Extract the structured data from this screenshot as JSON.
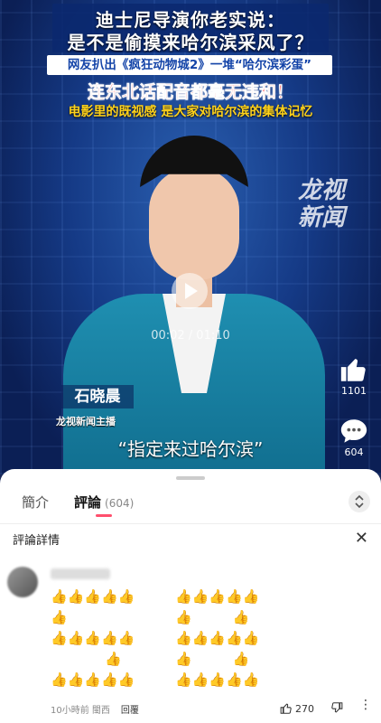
{
  "video": {
    "headline_line1": "迪士尼导演你老实说：",
    "headline_line2": "是不是偷摸来哈尔滨采风了？",
    "sub_banner": "网友扒出《疯狂动物城2》一堆“哈尔滨彩蛋”",
    "red_line": "连东北话配音都毫无违和！",
    "yellow_line": "电影里的既视感 是大家对哈尔滨的集体记忆",
    "watermark_line1": "龙视",
    "watermark_line2": "新闻",
    "time_display": "00:02 / 01:10",
    "anchor_name": "石晓晨",
    "anchor_title": "龙视新闻主播",
    "caption": "“指定来过哈尔滨”"
  },
  "side_actions": {
    "like_count": "1101",
    "comment_count": "604"
  },
  "sheet": {
    "tab_intro": "簡介",
    "tab_comments": "評論",
    "tab_comments_count": "(604)",
    "detail_title": "評論詳情",
    "close_label": "✕",
    "comment": {
      "emoji": "👍",
      "time": "10小時前 閩西",
      "reply_label": "回覆",
      "like_count": "270",
      "more": "⋮"
    }
  },
  "colors": {
    "accent": "#ff4f6d",
    "video_bg": "#153a86"
  }
}
